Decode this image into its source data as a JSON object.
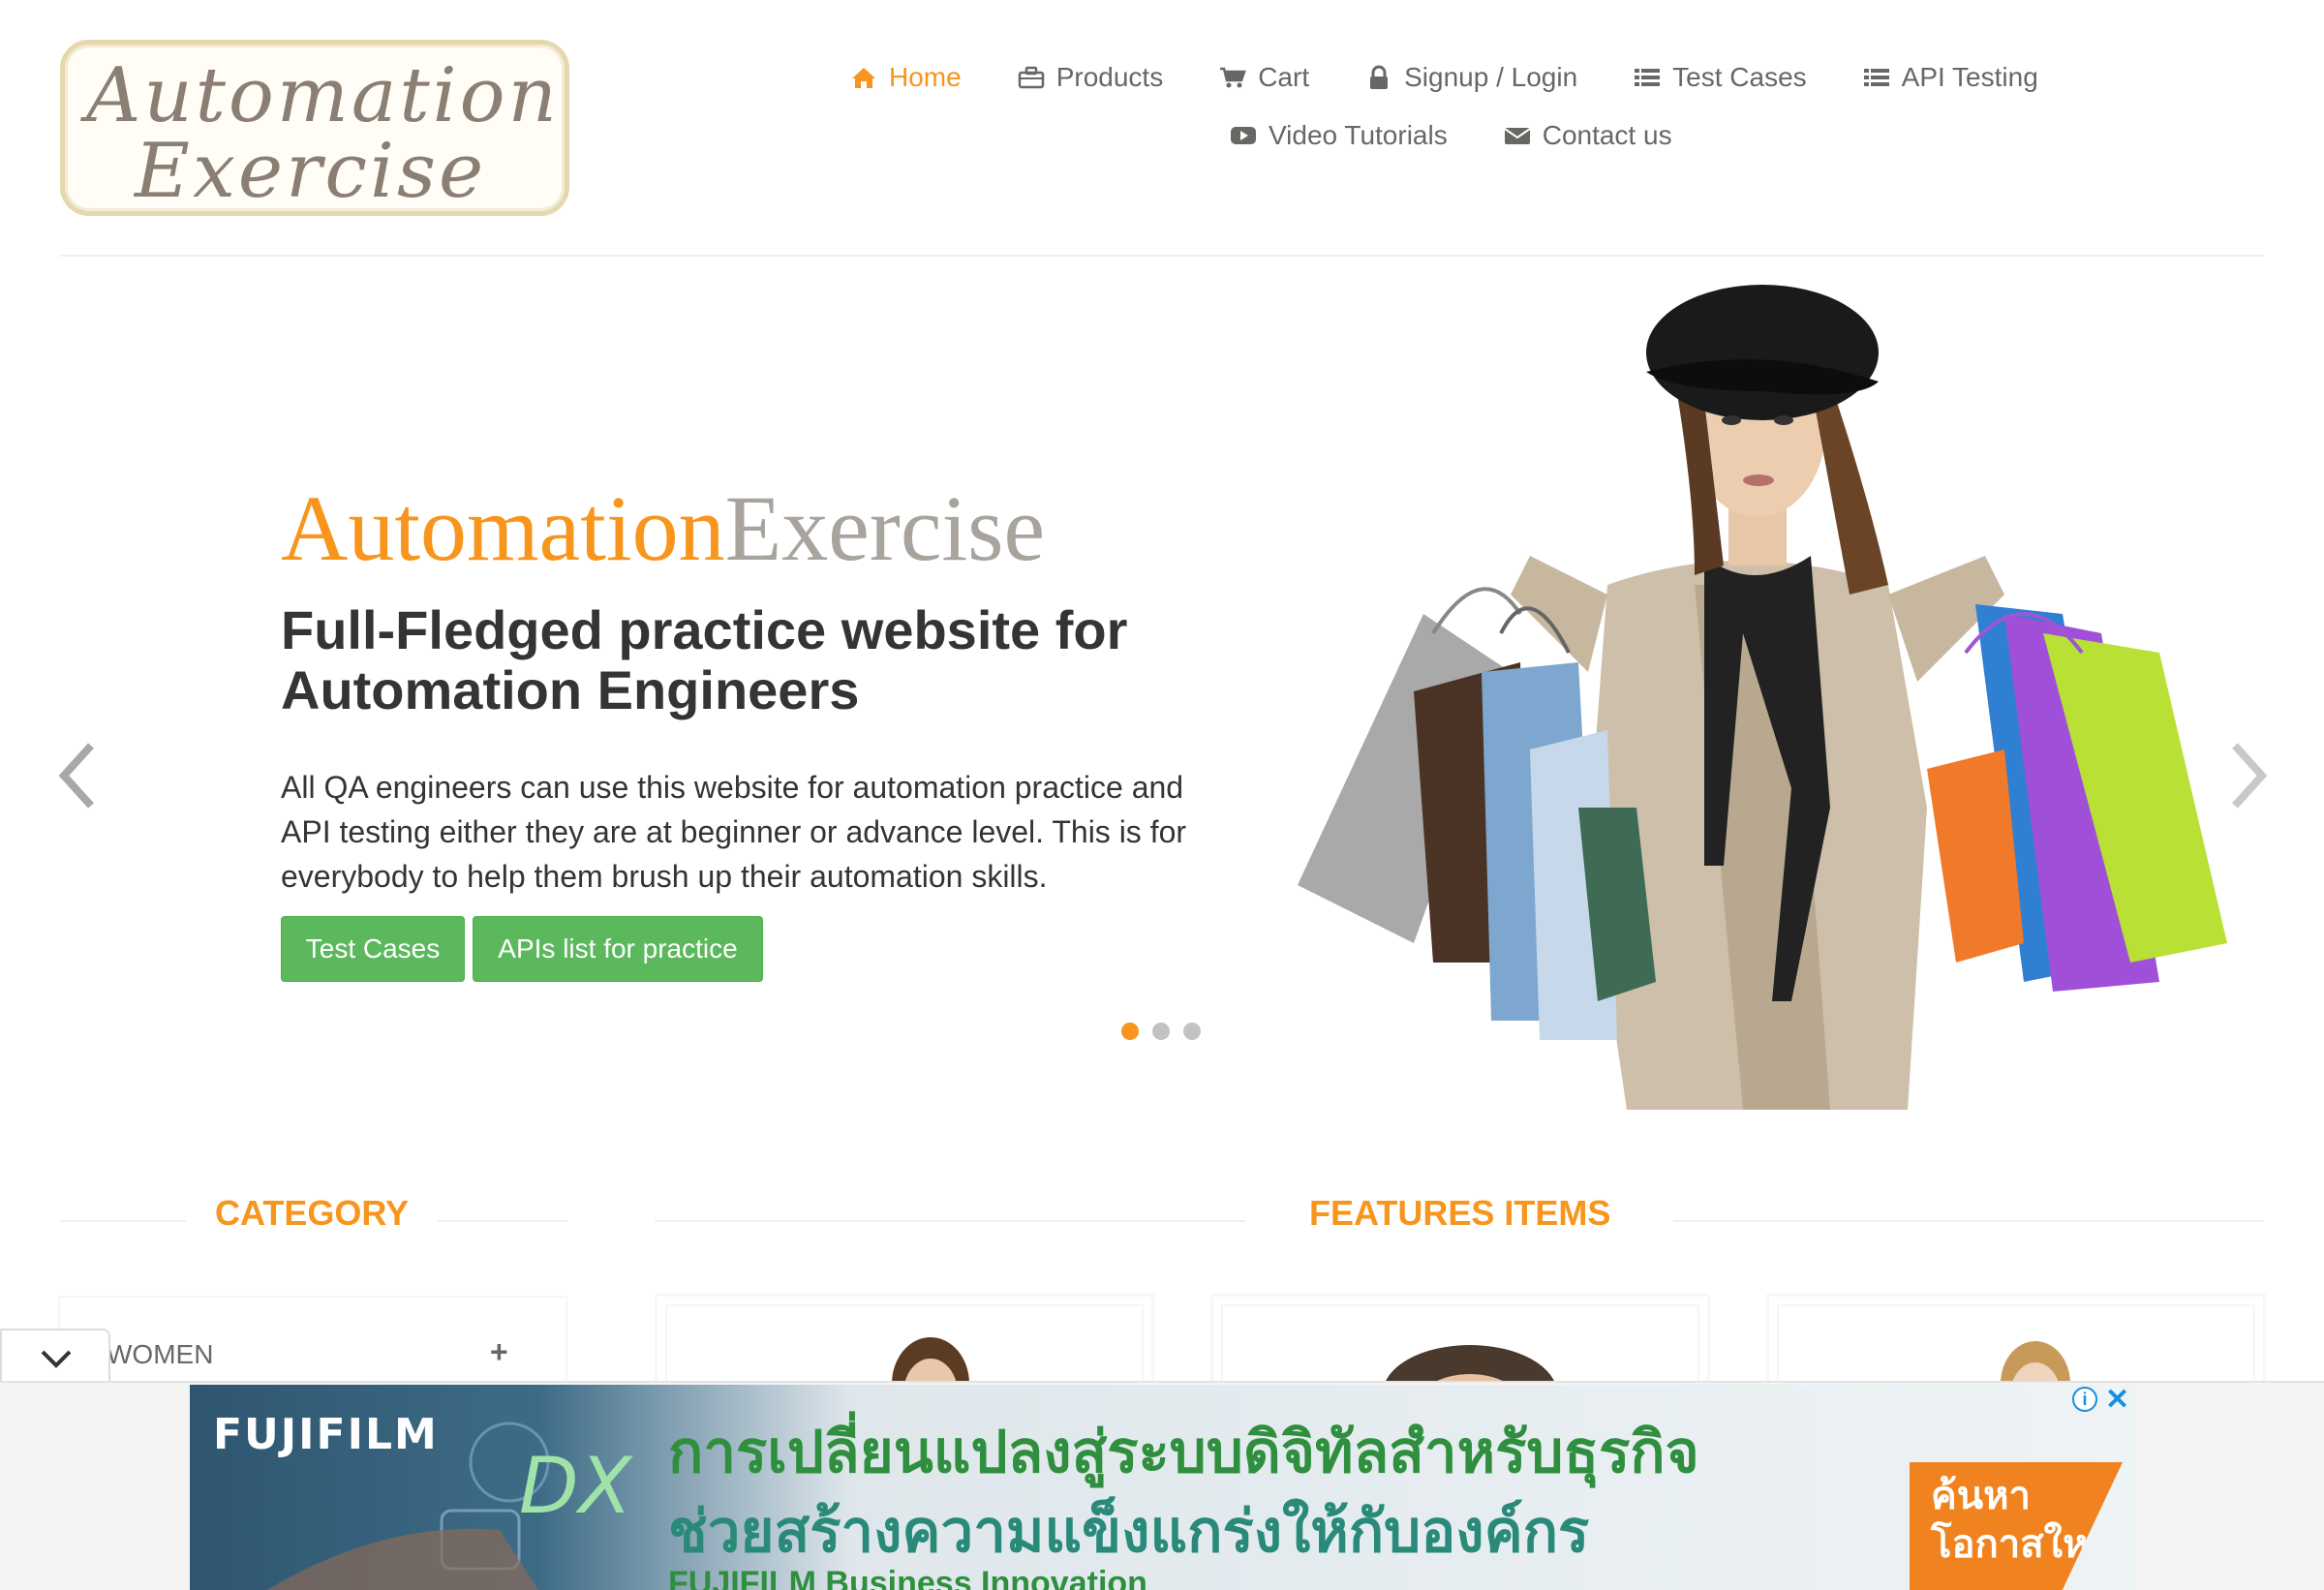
{
  "header": {
    "logo_line1": "Automation",
    "logo_line2": "Exercise",
    "nav": {
      "home": "Home",
      "products": "Products",
      "cart": "Cart",
      "signup_login": "Signup / Login",
      "test_cases": "Test Cases",
      "api_testing": "API Testing",
      "video_tutorials": "Video Tutorials",
      "contact_us": "Contact us"
    },
    "active_item": "Home",
    "active_color": "#f7951d"
  },
  "slider": {
    "brand_part1": "Automation",
    "brand_part2": "Exercise",
    "headline": "Full-Fledged practice website for Automation Engineers",
    "description": "All QA engineers can use this website for automation practice and API testing either they are at beginner or advance level. This is for everybody to help them brush up their automation skills.",
    "btn_test_cases": "Test Cases",
    "btn_apis": "APIs list for practice",
    "active_slide": 1,
    "slide_count": 3
  },
  "category": {
    "title": "CATEGORY",
    "items": [
      {
        "label": "WOMEN",
        "toggle": "+"
      }
    ]
  },
  "features": {
    "title": "FEATURES ITEMS"
  },
  "ad": {
    "brand": "FUJIFILM",
    "badge": "DX",
    "line1": "การเปลี่ยนแปลงสู่ระบบดิจิทัลสำหรับธุรกิจ",
    "line2": "ช่วยสร้างความแข็งแกร่งให้กับองค์กร",
    "subline": "FUJIFILM Business Innovation",
    "cta": "ค้นหาโอกาสใหม่",
    "info": "i",
    "close": "✕"
  },
  "colors": {
    "brand_orange": "#f7951d",
    "button_green": "#5cb85c",
    "text_dark": "#363432",
    "text_nav": "#696763"
  }
}
